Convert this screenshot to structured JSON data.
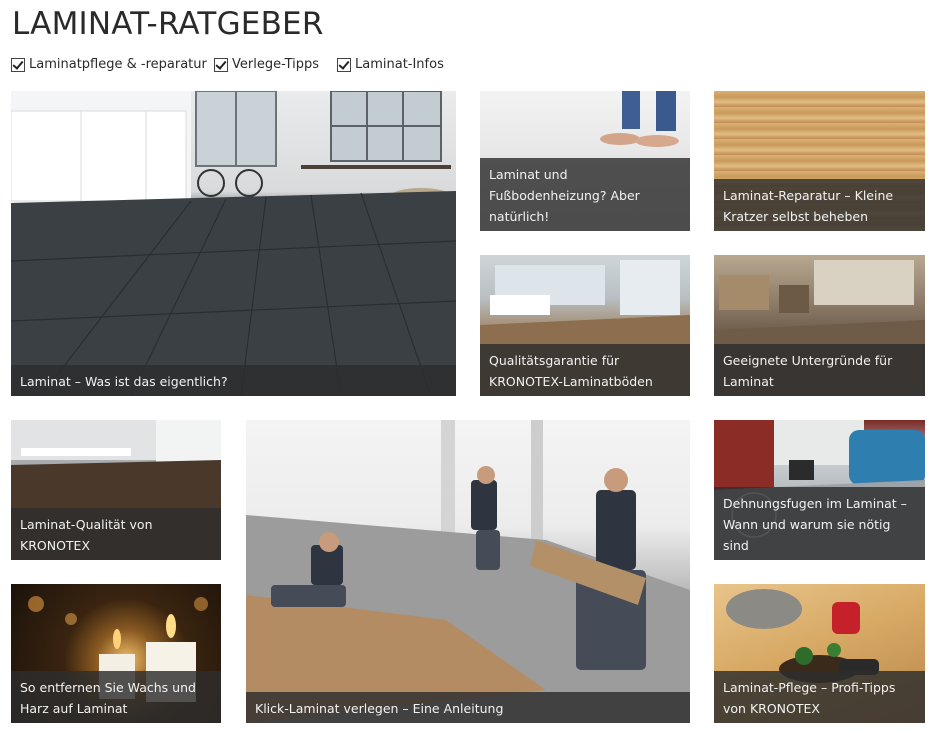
{
  "page": {
    "title": "LAMINAT-RATGEBER"
  },
  "filters": [
    {
      "label": "Laminatpflege & -reparatur",
      "checked": true
    },
    {
      "label": "Verlege-Tipps",
      "checked": true
    },
    {
      "label": "Laminat-Infos",
      "checked": true
    }
  ],
  "tiles": [
    {
      "caption": "Laminat – Was ist das eigentlich?"
    },
    {
      "caption": "Laminat und Fußbodenheizung? Aber natürlich!"
    },
    {
      "caption": "Laminat-Reparatur – Kleine Kratzer selbst beheben"
    },
    {
      "caption": "Qualitätsgarantie für KRONOTEX-Laminatböden"
    },
    {
      "caption": "Geeignete Untergründe für Laminat"
    },
    {
      "caption": "Laminat-Qualität von KRONOTEX"
    },
    {
      "caption": "Klick-Laminat verlegen – Eine Anleitung"
    },
    {
      "caption": "Dehnungsfugen im Laminat – Wann und warum sie nötig sind"
    },
    {
      "caption": "So entfernen Sie Wachs und Harz auf Laminat"
    },
    {
      "caption": "Laminat-Pflege – Profi-Tipps von KRONOTEX"
    }
  ]
}
